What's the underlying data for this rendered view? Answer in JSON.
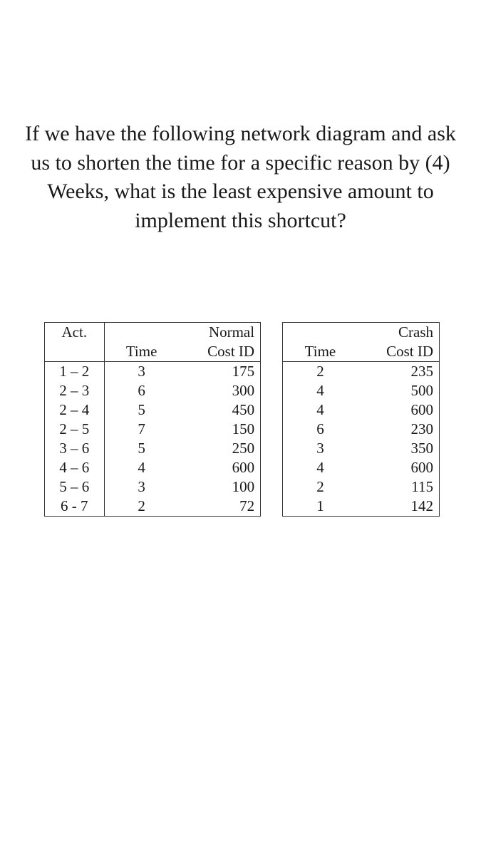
{
  "question": "If we have the following network diagram and ask us to shorten the time for a specific reason by (4) Weeks, what is the least expensive amount to implement this shortcut?",
  "headers": {
    "act": "Act.",
    "normal": "Normal",
    "crash": "Crash",
    "time": "Time",
    "costid": "Cost ID"
  },
  "rows": [
    {
      "act": "1 – 2",
      "ntime": "3",
      "ncost": "175",
      "ctime": "2",
      "ccost": "235"
    },
    {
      "act": "2 – 3",
      "ntime": "6",
      "ncost": "300",
      "ctime": "4",
      "ccost": "500"
    },
    {
      "act": "2 – 4",
      "ntime": "5",
      "ncost": "450",
      "ctime": "4",
      "ccost": "600"
    },
    {
      "act": "2 – 5",
      "ntime": "7",
      "ncost": "150",
      "ctime": "6",
      "ccost": "230"
    },
    {
      "act": "3 – 6",
      "ntime": "5",
      "ncost": "250",
      "ctime": "3",
      "ccost": "350"
    },
    {
      "act": "4 – 6",
      "ntime": "4",
      "ncost": "600",
      "ctime": "4",
      "ccost": "600"
    },
    {
      "act": "5 – 6",
      "ntime": "3",
      "ncost": "100",
      "ctime": "2",
      "ccost": "115"
    },
    {
      "act": "6 - 7",
      "ntime": "2",
      "ncost": "72",
      "ctime": "1",
      "ccost": "142"
    }
  ]
}
